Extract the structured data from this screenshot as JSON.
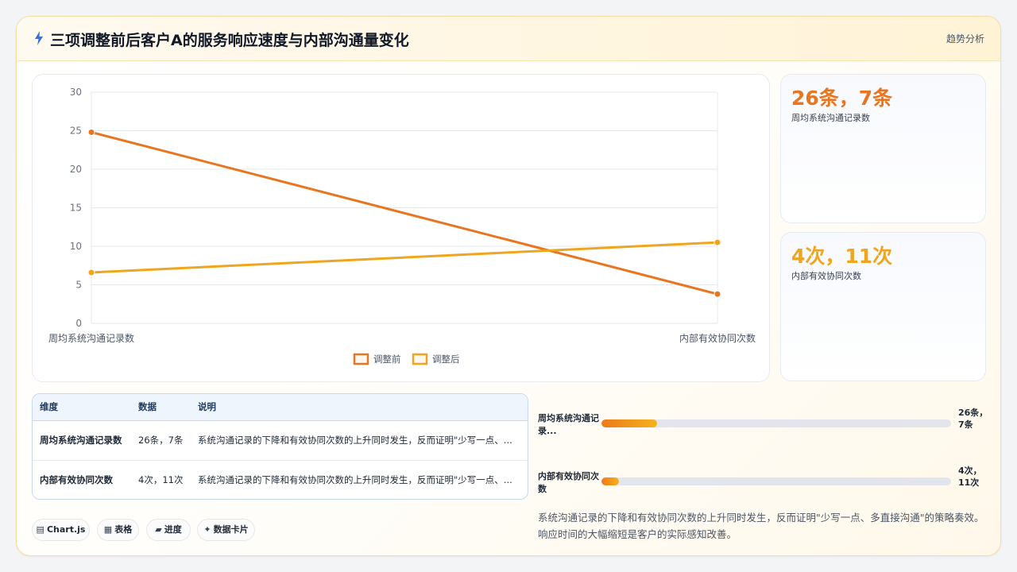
{
  "header": {
    "title": "三项调整前后客户A的服务响应速度与内部沟通量变化",
    "tag": "趋势分析"
  },
  "chart_data": {
    "type": "line",
    "categories": [
      "周均系统沟通记录数",
      "内部有效协同次数"
    ],
    "series": [
      {
        "name": "调整前",
        "values": [
          24.8,
          3.8
        ],
        "color": "#e8751f"
      },
      {
        "name": "调整后",
        "values": [
          6.6,
          10.5
        ],
        "color": "#f0a51e"
      }
    ],
    "ylim": [
      0,
      30
    ],
    "yticks": [
      0,
      5,
      10,
      15,
      20,
      25,
      30
    ],
    "legend": "bottom",
    "grid": true
  },
  "kpis": [
    {
      "value": "26条，7条",
      "label": "周均系统沟通记录数",
      "color": "#e8751f"
    },
    {
      "value": "4次，11次",
      "label": "内部有效协同次数",
      "color": "#f0a51e"
    }
  ],
  "table": {
    "headers": [
      "维度",
      "数据",
      "说明"
    ],
    "rows": [
      {
        "dim": "周均系统沟通记录数",
        "data": "26条，7条",
        "desc": "系统沟通记录的下降和有效协同次数的上升同时发生，反而证明\"少写一点、..."
      },
      {
        "dim": "内部有效协同次数",
        "data": "4次，11次",
        "desc": "系统沟通记录的下降和有效协同次数的上升同时发生，反而证明\"少写一点、..."
      }
    ]
  },
  "progress": [
    {
      "name": "周均系统沟通记录...",
      "value": "26条，7条",
      "fraction": 0.16
    },
    {
      "name": "内部有效协同次数",
      "value": "4次，11次",
      "fraction": 0.05
    }
  ],
  "summary": "系统沟通记录的下降和有效协同次数的上升同时发生，反而证明\"少写一点、多直接沟通\"的策略奏效。响应时间的大幅缩短是客户的实际感知改善。",
  "chips": [
    {
      "icon": "▤",
      "label": "Chart.js"
    },
    {
      "icon": "▦",
      "label": "表格"
    },
    {
      "icon": "▰",
      "label": "进度"
    },
    {
      "icon": "✦",
      "label": "数据卡片"
    }
  ]
}
